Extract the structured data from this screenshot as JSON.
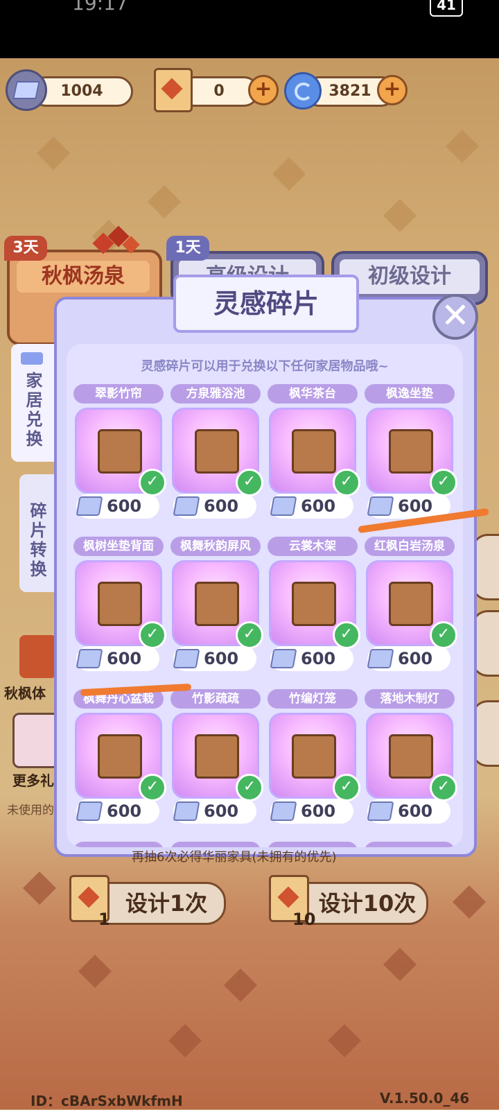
{
  "status_bar": {
    "time": "19:17",
    "battery": "41"
  },
  "currencies": [
    {
      "name": "灵感碎片",
      "value": "1004"
    },
    {
      "name": "设计卷轴",
      "value": "0"
    },
    {
      "name": "星旋",
      "value": "3821"
    }
  ],
  "plus_symbol": "+",
  "tabs": [
    {
      "tag": "3天",
      "label": "秋枫汤泉"
    },
    {
      "tag": "1天",
      "label": "高级设计"
    },
    {
      "tag": "",
      "label": "初级设计"
    }
  ],
  "side_tabs": [
    {
      "label": "家居兑换"
    },
    {
      "label": "碎片转换"
    }
  ],
  "modal": {
    "title": "灵感碎片",
    "description": "灵感碎片可以用于兑换以下任何家居物品哦~",
    "close_symbol": "✕",
    "items": [
      {
        "name": "翠影竹帘",
        "price": "600"
      },
      {
        "name": "方泉雅浴池",
        "price": "600"
      },
      {
        "name": "枫华茶台",
        "price": "600"
      },
      {
        "name": "枫逸坐垫",
        "price": "600"
      },
      {
        "name": "枫树坐垫背面",
        "price": "600"
      },
      {
        "name": "枫舞秋韵屏风",
        "price": "600"
      },
      {
        "name": "云裳木架",
        "price": "600"
      },
      {
        "name": "红枫白岩汤泉",
        "price": "600"
      },
      {
        "name": "枫舞丹心盆栽",
        "price": "600"
      },
      {
        "name": "竹影疏疏",
        "price": "600"
      },
      {
        "name": "竹编灯笼",
        "price": "600"
      },
      {
        "name": "落地木制灯",
        "price": "600"
      }
    ]
  },
  "left_labels": {
    "a": "秋枫体",
    "b": "更多礼",
    "c": "未使用的"
  },
  "bottom": {
    "note": "再抽6次必得华丽家具(未拥有的优先)",
    "design_once": "设计1次",
    "design_once_count": "1",
    "design_ten": "设计10次",
    "design_ten_count": "10"
  },
  "footer": {
    "id": "ID：cBArSxbWkfmH",
    "version": "V.1.50.0_46"
  }
}
